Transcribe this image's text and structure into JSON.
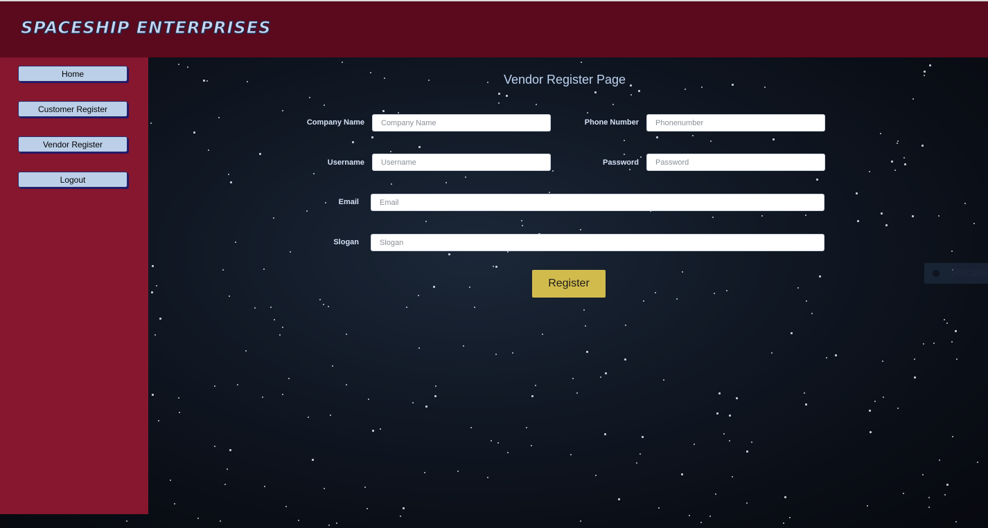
{
  "header": {
    "brand": "Spaceship Enterprises"
  },
  "sidebar": {
    "items": [
      {
        "label": "Home"
      },
      {
        "label": "Customer Register"
      },
      {
        "label": "Vendor Register"
      },
      {
        "label": "Logout"
      }
    ]
  },
  "main": {
    "title": "Vendor Register Page",
    "fields": {
      "company_name": {
        "label": "Company Name",
        "placeholder": "Company Name",
        "value": ""
      },
      "phone_number": {
        "label": "Phone Number",
        "placeholder": "Phonenumber",
        "value": ""
      },
      "username": {
        "label": "Username",
        "placeholder": "Username",
        "value": ""
      },
      "password": {
        "label": "Password",
        "placeholder": "Password",
        "value": ""
      },
      "email": {
        "label": "Email",
        "placeholder": "Email",
        "value": ""
      },
      "slogan": {
        "label": "Slogan",
        "placeholder": "Slogan",
        "value": ""
      }
    },
    "register_label": "Register"
  },
  "overlay": {
    "partial_text": "Rectan"
  },
  "colors": {
    "header_bg": "#5a0a1c",
    "sidebar_bg": "#86172f",
    "nav_button_bg": "#bccfe8",
    "register_button_bg": "#d2bb4d",
    "title_color": "#bcd2f0",
    "space_bg": "#121a27"
  }
}
